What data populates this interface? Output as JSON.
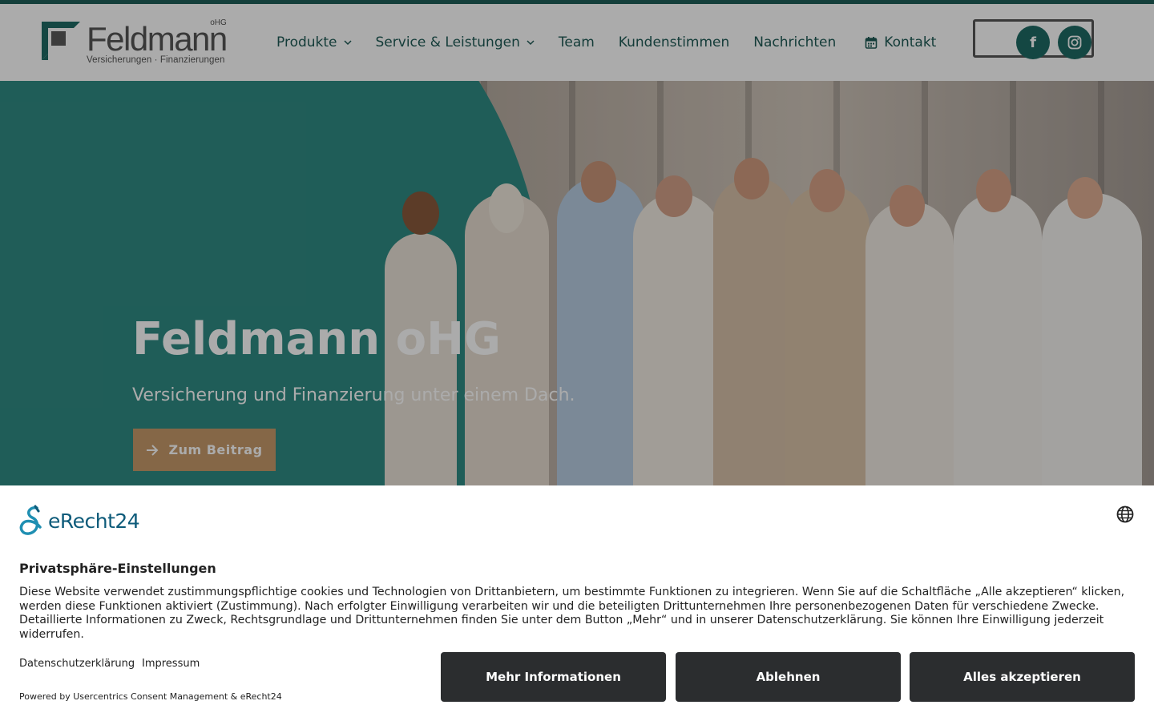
{
  "header": {
    "logo": {
      "name": "Feldmann",
      "suffix": "oHG",
      "subtitle": "Versicherungen · Finanzierungen"
    },
    "nav": [
      {
        "label": "Produkte",
        "has_dropdown": true
      },
      {
        "label": "Service & Leistungen",
        "has_dropdown": true
      },
      {
        "label": "Team",
        "has_dropdown": false
      },
      {
        "label": "Kundenstimmen",
        "has_dropdown": false
      },
      {
        "label": "Nachrichten",
        "has_dropdown": false
      },
      {
        "label": "Kontakt",
        "icon": "calendar-icon"
      }
    ],
    "social": [
      {
        "icon": "facebook-icon",
        "glyph": "f"
      },
      {
        "icon": "instagram-icon"
      }
    ],
    "accent_color": "#1f5e59"
  },
  "hero": {
    "title": "Feldmann oHG",
    "subtitle": "Versicherung und Finanzierung unter einem Dach.",
    "button_label": "Zum Beitrag",
    "button_color": "#c79a6a",
    "shape_color": "#2f8b83"
  },
  "consent": {
    "brand": "eRecht24",
    "title": "Privatsphäre-Einstellungen",
    "text": "Diese Website verwendet zustimmungspflichtige cookies und Technologien von Drittanbietern, um bestimmte Funktionen zu integrieren. Wenn Sie auf die Schaltfläche „Alle akzeptieren“ klicken, werden diese Funktionen aktiviert (Zustimmung). Nach erfolgter Einwilligung verarbeiten wir und die beteiligten Drittunternehmen Ihre personenbezogenen Daten für verschiedene Zwecke. Detaillierte Informationen zu Zweck, Rechtsgrundlage und Drittunternehmen finden Sie unter dem Button „Mehr“ und in unserer Datenschutzerklärung. Sie können Ihre Einwilligung jederzeit widerrufen.",
    "links": {
      "privacy": "Datenschutzerklärung",
      "imprint": "Impressum"
    },
    "powered_by": "Powered by Usercentrics Consent Management & eRecht24",
    "buttons": {
      "more": "Mehr Informationen",
      "decline": "Ablehnen",
      "accept": "Alles akzeptieren"
    },
    "button_color": "#2b2d2f",
    "brand_color": "#0e5b7a"
  }
}
